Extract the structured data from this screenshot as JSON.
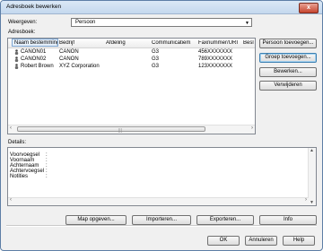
{
  "window": {
    "title": "Adresboek bewerken",
    "close_label": "x"
  },
  "weergeven": {
    "label": "Weergeven:",
    "value": "Persoon",
    "arrow": "▼"
  },
  "adresboek_label": "Adresboek:",
  "columns": [
    "Naam bestemming",
    "Bedrijf",
    "Afdeling",
    "Communicatiem...",
    "Faxnummer/URI",
    "Besl"
  ],
  "rows": [
    {
      "name": "CANON01",
      "company": "CANON",
      "dept": "",
      "comm": "G3",
      "fax": "456XXXXXXX"
    },
    {
      "name": "CANON02",
      "company": "CANON",
      "dept": "",
      "comm": "G3",
      "fax": "789XXXXXXX"
    },
    {
      "name": "Robert Brown",
      "company": "XYZ Corporation",
      "dept": "",
      "comm": "G3",
      "fax": "123XXXXXXX"
    }
  ],
  "side_buttons": {
    "add_person": "Persoon toevoegen...",
    "add_group": "Groep toevoegen...",
    "edit": "Bewerken...",
    "delete": "Verwijderen"
  },
  "details": {
    "label": "Details:",
    "fields": [
      {
        "key": "Voorvoegsel",
        "colon": ":"
      },
      {
        "key": "Voornaam",
        "colon": ":"
      },
      {
        "key": "Achternaam",
        "colon": ":"
      },
      {
        "key": "Achtervoegsel",
        "colon": ":"
      },
      {
        "key": "Notities",
        "colon": ":"
      }
    ]
  },
  "bottom_buttons": {
    "folder": "Map opgeven...",
    "import": "Importeren...",
    "export": "Exporteren...",
    "info": "Info"
  },
  "footer_buttons": {
    "ok": "OK",
    "cancel": "Annuleren",
    "help": "Help"
  }
}
